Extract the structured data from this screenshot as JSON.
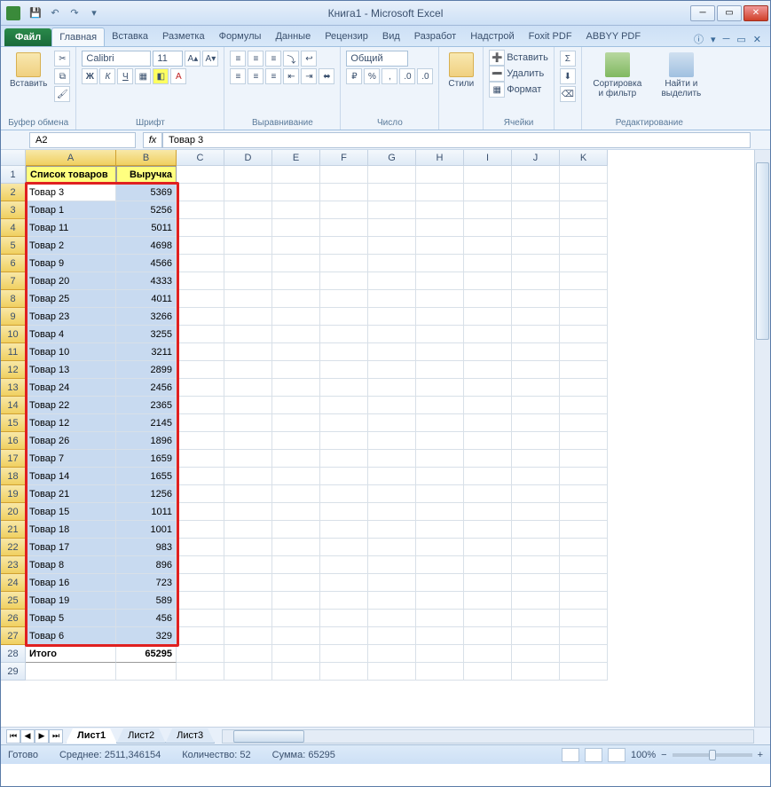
{
  "title": "Книга1 - Microsoft Excel",
  "tabs": {
    "file": "Файл",
    "list": [
      "Главная",
      "Вставка",
      "Разметка",
      "Формулы",
      "Данные",
      "Рецензир",
      "Вид",
      "Разработ",
      "Надстрой",
      "Foxit PDF",
      "ABBYY PDF"
    ],
    "activeIndex": 0
  },
  "ribbon": {
    "paste": "Вставить",
    "clipboard": "Буфер обмена",
    "fontName": "Calibri",
    "fontSize": "11",
    "font": "Шрифт",
    "alignment": "Выравнивание",
    "numberFormat": "Общий",
    "number": "Число",
    "styles": "Стили",
    "insertBtn": "Вставить",
    "deleteBtn": "Удалить",
    "formatBtn": "Формат",
    "cells": "Ячейки",
    "sortFilter": "Сортировка и фильтр",
    "findSelect": "Найти и выделить",
    "editing": "Редактирование"
  },
  "namebox": "A2",
  "formula": "Товар 3",
  "columns": [
    "A",
    "B",
    "C",
    "D",
    "E",
    "F",
    "G",
    "H",
    "I",
    "J",
    "K"
  ],
  "headerRow": {
    "a": "Список товаров",
    "b": "Выручка"
  },
  "rows": [
    {
      "n": 2,
      "a": "Товар 3",
      "b": 5369
    },
    {
      "n": 3,
      "a": "Товар 1",
      "b": 5256
    },
    {
      "n": 4,
      "a": "Товар 11",
      "b": 5011
    },
    {
      "n": 5,
      "a": "Товар 2",
      "b": 4698
    },
    {
      "n": 6,
      "a": "Товар 9",
      "b": 4566
    },
    {
      "n": 7,
      "a": "Товар 20",
      "b": 4333
    },
    {
      "n": 8,
      "a": "Товар 25",
      "b": 4011
    },
    {
      "n": 9,
      "a": "Товар 23",
      "b": 3266
    },
    {
      "n": 10,
      "a": "Товар 4",
      "b": 3255
    },
    {
      "n": 11,
      "a": "Товар 10",
      "b": 3211
    },
    {
      "n": 12,
      "a": "Товар 13",
      "b": 2899
    },
    {
      "n": 13,
      "a": "Товар 24",
      "b": 2456
    },
    {
      "n": 14,
      "a": "Товар 22",
      "b": 2365
    },
    {
      "n": 15,
      "a": "Товар 12",
      "b": 2145
    },
    {
      "n": 16,
      "a": "Товар 26",
      "b": 1896
    },
    {
      "n": 17,
      "a": "Товар 7",
      "b": 1659
    },
    {
      "n": 18,
      "a": "Товар 14",
      "b": 1655
    },
    {
      "n": 19,
      "a": "Товар 21",
      "b": 1256
    },
    {
      "n": 20,
      "a": "Товар 15",
      "b": 1011
    },
    {
      "n": 21,
      "a": "Товар 18",
      "b": 1001
    },
    {
      "n": 22,
      "a": "Товар 17",
      "b": 983
    },
    {
      "n": 23,
      "a": "Товар 8",
      "b": 896
    },
    {
      "n": 24,
      "a": "Товар 16",
      "b": 723
    },
    {
      "n": 25,
      "a": "Товар 19",
      "b": 589
    },
    {
      "n": 26,
      "a": "Товар 5",
      "b": 456
    },
    {
      "n": 27,
      "a": "Товар 6",
      "b": 329
    }
  ],
  "totals": {
    "n": 28,
    "a": "Итого",
    "b": 65295
  },
  "extraRows": [
    29
  ],
  "sheets": [
    "Лист1",
    "Лист2",
    "Лист3"
  ],
  "activeSheet": 0,
  "status": {
    "ready": "Готово",
    "avgLabel": "Среднее:",
    "avg": "2511,346154",
    "countLabel": "Количество:",
    "count": "52",
    "sumLabel": "Сумма:",
    "sum": "65295",
    "zoom": "100%"
  }
}
